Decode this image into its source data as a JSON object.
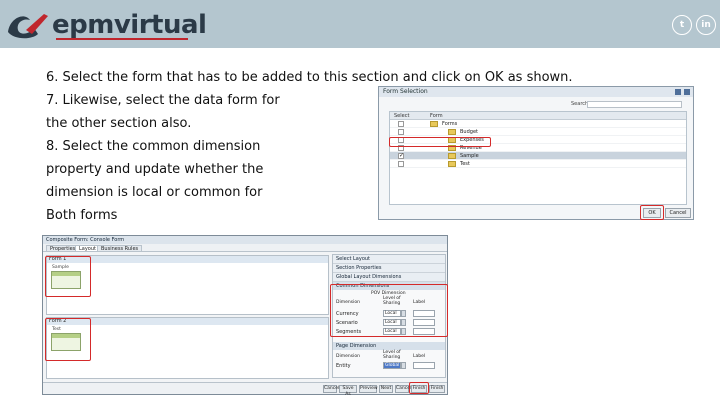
{
  "header": {
    "brand_text": "epmvirtual",
    "social": {
      "twitter_glyph": "t",
      "linkedin_glyph": "in"
    },
    "colors": {
      "bar": "#b4c6cf",
      "brand_dark": "#2b3a47",
      "brand_red": "#c0262d"
    }
  },
  "slide": {
    "lines": [
      "6. Select the form that has to be added to this section and click on OK as shown.",
      "7. Likewise, select the data form for",
      "the other section also.",
      "8. Select the common dimension",
      "property and update whether the",
      "dimension is local or common for",
      "Both forms"
    ]
  },
  "form_selection_dialog": {
    "title": "Form Selection",
    "search_label": "Search",
    "columns": [
      "Select",
      "Form"
    ],
    "rows": [
      {
        "name": "Forms",
        "selected": false
      },
      {
        "name": "Budget",
        "selected": false
      },
      {
        "name": "Expenses",
        "selected": false
      },
      {
        "name": "Revenue",
        "selected": false
      },
      {
        "name": "Sample",
        "selected": true
      },
      {
        "name": "Test",
        "selected": false
      }
    ],
    "ok_label": "OK",
    "cancel_label": "Cancel"
  },
  "composite_form": {
    "title": "Composite Form: Console Form",
    "tabs": [
      "Properties",
      "Layout",
      "Business Rules"
    ],
    "active_tab": "Layout",
    "sections": [
      {
        "header": "Form 1",
        "form_label": "Sample"
      },
      {
        "header": "Form 2",
        "form_label": "Test"
      }
    ],
    "right_panel": {
      "accordion": [
        "Select Layout",
        "Section Properties",
        "Global Layout Dimensions"
      ],
      "common_dimensions": {
        "header": "Common Dimensions",
        "pov_label": "POV Dimension",
        "col_dimension": "Dimension",
        "col_level": "Level of Sharing",
        "col_label": "Label",
        "rows": [
          {
            "dimension": "Currency",
            "level": "Local"
          },
          {
            "dimension": "Scenario",
            "level": "Local"
          },
          {
            "dimension": "Segments",
            "level": "Local"
          }
        ]
      },
      "page_dimensions": {
        "header": "Page Dimension",
        "col_dimension": "Dimension",
        "col_level": "Level of Sharing",
        "col_label": "Label",
        "rows": [
          {
            "dimension": "Entity",
            "level": "Global"
          }
        ]
      }
    },
    "footer_buttons": [
      "Cancel",
      "Save As",
      "Preview",
      "Next",
      "Cancel",
      "Finish",
      "Finish"
    ]
  }
}
